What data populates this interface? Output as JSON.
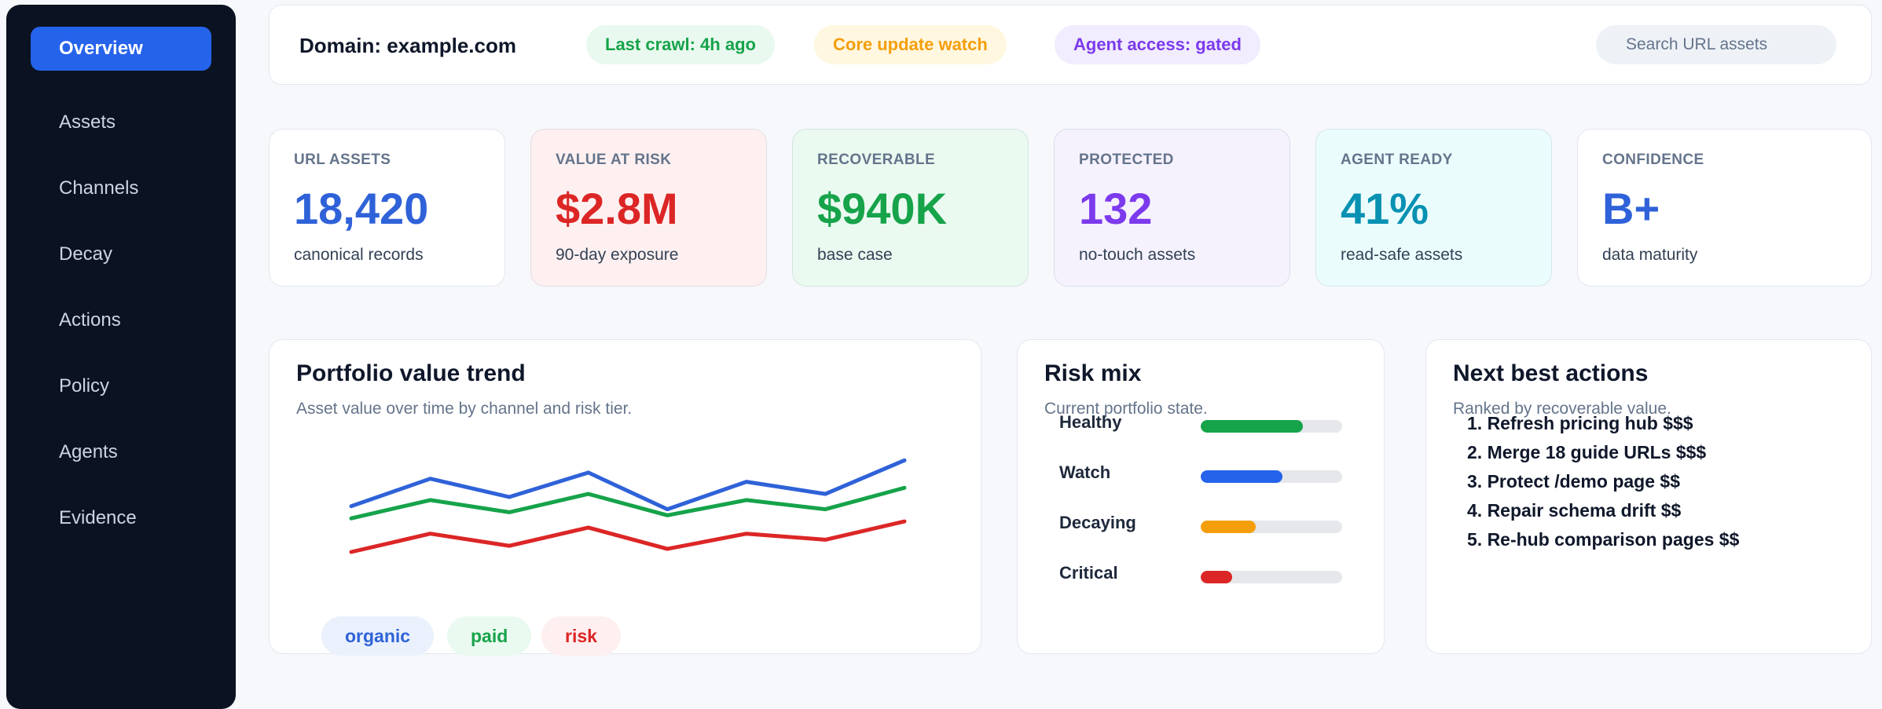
{
  "sidebar": {
    "items": [
      {
        "label": "Overview",
        "active": true
      },
      {
        "label": "Assets"
      },
      {
        "label": "Channels"
      },
      {
        "label": "Decay"
      },
      {
        "label": "Actions"
      },
      {
        "label": "Policy"
      },
      {
        "label": "Agents"
      },
      {
        "label": "Evidence"
      }
    ]
  },
  "topbar": {
    "domain": "Domain: example.com",
    "last_crawl": "Last crawl: 4h ago",
    "core_update": "Core update watch",
    "agent_access": "Agent access: gated",
    "search_placeholder": "Search URL assets"
  },
  "kpis": [
    {
      "label": "URL ASSETS",
      "value": "18,420",
      "sub": "canonical records",
      "color": "#2f62d8",
      "bg": "#ffffff"
    },
    {
      "label": "VALUE AT RISK",
      "value": "$2.8M",
      "sub": "90-day exposure",
      "color": "#dc2626",
      "bg": "#fef0f0"
    },
    {
      "label": "RECOVERABLE",
      "value": "$940K",
      "sub": "base case",
      "color": "#16a34a",
      "bg": "#eafaf0"
    },
    {
      "label": "PROTECTED",
      "value": "132",
      "sub": "no-touch assets",
      "color": "#7c3aed",
      "bg": "#f5f2fe"
    },
    {
      "label": "AGENT READY",
      "value": "41%",
      "sub": "read-safe assets",
      "color": "#0891b2",
      "bg": "#ebfcfd"
    },
    {
      "label": "CONFIDENCE",
      "value": "B+",
      "sub": "data maturity",
      "color": "#2f62d8",
      "bg": "#ffffff"
    }
  ],
  "trend": {
    "title": "Portfolio value trend",
    "subtitle": "Asset value over time by channel and risk tier.",
    "legend": [
      "organic",
      "paid",
      "risk"
    ]
  },
  "chart_data": {
    "type": "line",
    "x": [
      1,
      2,
      3,
      4,
      5,
      6,
      7,
      8
    ],
    "series": [
      {
        "name": "organic",
        "color": "#2f62d8",
        "values": [
          68,
          86,
          74,
          90,
          66,
          84,
          76,
          98
        ]
      },
      {
        "name": "paid",
        "color": "#16a34a",
        "values": [
          60,
          72,
          64,
          76,
          62,
          72,
          66,
          80
        ]
      },
      {
        "name": "risk",
        "color": "#dc2626",
        "values": [
          38,
          50,
          42,
          54,
          40,
          50,
          46,
          58
        ]
      }
    ],
    "ylim": [
      20,
      110
    ],
    "grid": false,
    "legend_position": "bottom-left"
  },
  "risk_mix": {
    "title": "Risk mix",
    "subtitle": "Current portfolio state.",
    "rows": [
      {
        "label": "Healthy",
        "fraction": 0.72,
        "color": "#16a34a"
      },
      {
        "label": "Watch",
        "fraction": 0.58,
        "color": "#2563eb"
      },
      {
        "label": "Decaying",
        "fraction": 0.39,
        "color": "#f59e0b"
      },
      {
        "label": "Critical",
        "fraction": 0.22,
        "color": "#dc2626"
      }
    ]
  },
  "actions": {
    "title": "Next best actions",
    "subtitle": "Ranked by recoverable value.",
    "items": [
      "1. Refresh pricing hub $$$",
      "2. Merge 18 guide URLs $$$",
      "3. Protect /demo page $$",
      "4. Repair schema drift $$",
      "5. Re-hub comparison pages $$"
    ]
  }
}
